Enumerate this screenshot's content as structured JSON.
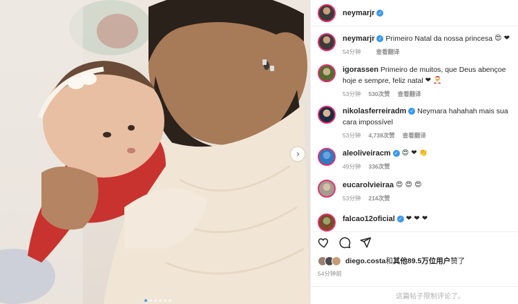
{
  "post": {
    "author": "neymarjr",
    "slide_dots": 6,
    "active_dot": 0
  },
  "comments": [
    {
      "user": "neymarjr",
      "verified": true,
      "avatar_class": "",
      "text": "Primeiro Natal da nossa princesa",
      "emojis": "😍 ❤",
      "time": "54分钟",
      "likes": "",
      "reply": "查看翻译"
    },
    {
      "user": "igorassen",
      "verified": false,
      "avatar_class": "g2",
      "text": "Primeiro de muitos, que Deus abençoe hoje e sempre, feliz natal",
      "emojis": "❤ 🎅",
      "time": "53分钟",
      "likes": "530次赞",
      "reply": "查看翻译"
    },
    {
      "user": "nikolasferreiradm",
      "verified": true,
      "avatar_class": "g3",
      "text": "Neymara hahahah mais sua cara impossível",
      "emojis": "",
      "time": "53分钟",
      "likes": "4,738次赞",
      "reply": "查看翻译"
    },
    {
      "user": "aleoliveiracm",
      "verified": true,
      "avatar_class": "g4",
      "text": "",
      "emojis": "😍 ❤ 👏",
      "time": "49分钟",
      "likes": "336次赞",
      "reply": ""
    },
    {
      "user": "eucarolvieiraa",
      "verified": false,
      "avatar_class": "g5",
      "text": "",
      "emojis": "😍 😍 😍",
      "time": "53分钟",
      "likes": "214次赞",
      "reply": ""
    },
    {
      "user": "falcao12oficial",
      "verified": true,
      "avatar_class": "g6",
      "text": "",
      "emojis": "❤ ❤ ❤",
      "time": "",
      "likes": "",
      "reply": ""
    }
  ],
  "actions": {
    "like_icon": "heart-icon",
    "comment_icon": "comment-icon",
    "share_icon": "share-icon"
  },
  "likes_line": {
    "user": "diego.costa",
    "mid": "和",
    "others": "其他89.5万位用户",
    "end": "赞了"
  },
  "post_time": "54分钟前",
  "comments_closed": "这篇帖子限制评论了。",
  "colors": {
    "verified": "#3897f0",
    "ring": "#e1306c",
    "muted": "#8e8e8e"
  }
}
